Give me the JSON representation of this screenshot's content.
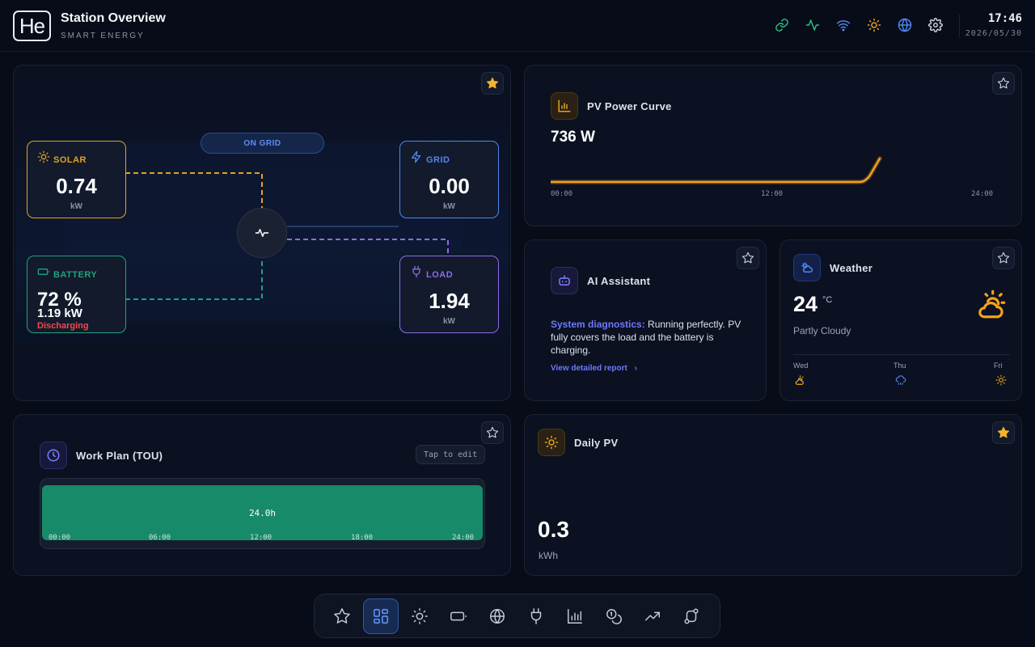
{
  "header": {
    "logo": "He",
    "title": "Station Overview",
    "subtitle": "SMART ENERGY",
    "time": "17:46",
    "date": "2026/05/30",
    "status_icons": [
      "link-icon",
      "activity-icon",
      "wifi-icon",
      "sun-icon",
      "globe-icon",
      "gear-icon"
    ]
  },
  "energy_flow": {
    "status": "ON GRID",
    "favorited": true,
    "solar": {
      "label": "SOLAR",
      "value": "0.74",
      "unit": "kW"
    },
    "grid": {
      "label": "GRID",
      "value": "0.00",
      "unit": "kW"
    },
    "battery": {
      "label": "BATTERY",
      "percent": "72 %",
      "power": "1.19 kW",
      "state": "Discharging"
    },
    "load": {
      "label": "LOAD",
      "value": "1.94",
      "unit": "kW"
    }
  },
  "pv_curve": {
    "title": "PV Power Curve",
    "value": "736 W",
    "favorited": false,
    "ticks": [
      "00:00",
      "12:00",
      "24:00"
    ]
  },
  "ai_assistant": {
    "title": "AI Assistant",
    "label": "System diagnostics:",
    "message": " Running perfectly. PV fully covers the load and the battery is charging.",
    "link": "View detailed report",
    "favorited": false
  },
  "weather": {
    "title": "Weather",
    "temp": "24",
    "unit": "°C",
    "condition": "Partly Cloudy",
    "favorited": false,
    "forecast": [
      {
        "day": "Wed",
        "icon": "partly-cloudy-icon"
      },
      {
        "day": "Thu",
        "icon": "rain-icon"
      },
      {
        "day": "Fri",
        "icon": "sun-icon"
      }
    ]
  },
  "work_plan": {
    "title": "Work Plan (TOU)",
    "edit_label": "Tap to edit",
    "bar_label": "24.0h",
    "ticks": [
      "00:00",
      "06:00",
      "12:00",
      "18:00",
      "24:00"
    ],
    "favorited": false
  },
  "daily_pv": {
    "title": "Daily PV",
    "value": "0.3",
    "unit": "kWh",
    "favorited": true
  },
  "colors": {
    "solar": "#e6a21e",
    "grid": "#4f86ee",
    "battery": "#22a37c",
    "load": "#8e6ce6",
    "discharging": "#ef4b4b",
    "accent": "#6d78ff"
  },
  "dock": {
    "active": "dashboard-icon",
    "items": [
      "star-icon",
      "dashboard-icon",
      "sun-icon",
      "battery-icon",
      "globe-icon",
      "plug-icon",
      "bar-chart-icon",
      "coins-icon",
      "trending-up-icon",
      "route-icon"
    ]
  }
}
